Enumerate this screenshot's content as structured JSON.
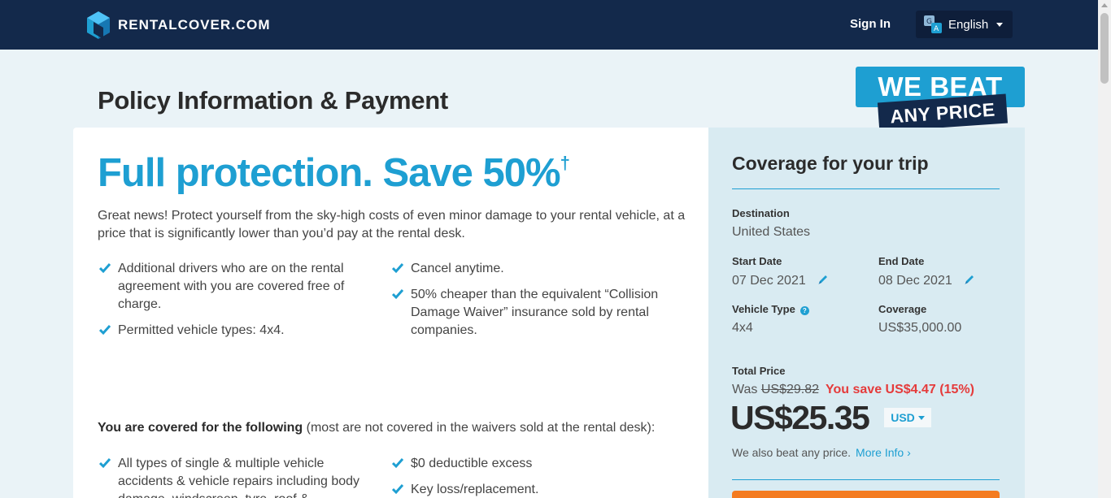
{
  "header": {
    "logo_text": "RENTALCOVER.COM",
    "sign_in": "Sign In",
    "language": "English"
  },
  "page_title": "Policy Information & Payment",
  "badge": {
    "line1": "WE BEAT",
    "line2": "ANY PRICE"
  },
  "main": {
    "headline": "Full protection. Save 50%",
    "headline_mark": "†",
    "intro": "Great news! Protect yourself from the sky-high costs of even minor damage to your rental vehicle, at a price that is significantly lower than you’d pay at the rental desk.",
    "features_left": [
      "Additional drivers who are on the rental agreement with you are covered free of charge.",
      "Permitted vehicle types: 4x4."
    ],
    "features_right": [
      "Cancel anytime.",
      "50% cheaper than the equivalent “Collision Damage Waiver” insurance sold by rental companies."
    ],
    "covered_heading": "You are covered for the following",
    "covered_note": " (most are not covered in the waivers sold at the rental desk):",
    "covered_left": [
      "All types of single & multiple vehicle accidents & vehicle repairs including body damage, windscreen, tyre, roof &"
    ],
    "covered_right": [
      "$0 deductible excess",
      "Key loss/replacement."
    ]
  },
  "side": {
    "title": "Coverage for your trip",
    "destination_label": "Destination",
    "destination": "United States",
    "start_label": "Start Date",
    "start": "07 Dec 2021",
    "end_label": "End Date",
    "end": "08 Dec 2021",
    "vehicle_label": "Vehicle Type",
    "vehicle": "4x4",
    "coverage_label": "Coverage",
    "coverage": "US$35,000.00",
    "total_label": "Total Price",
    "was_label": "Was",
    "was_price": "US$29.82",
    "you_save": "You save US$4.47 (15%)",
    "price": "US$25.35",
    "currency": "USD",
    "beat_text": "We also beat any price.",
    "more_info": "More Info ›"
  },
  "colors": {
    "navy": "#13294b",
    "accent": "#1e9fd2",
    "save_red": "#e53b3b",
    "cta_orange": "#f47b20"
  }
}
